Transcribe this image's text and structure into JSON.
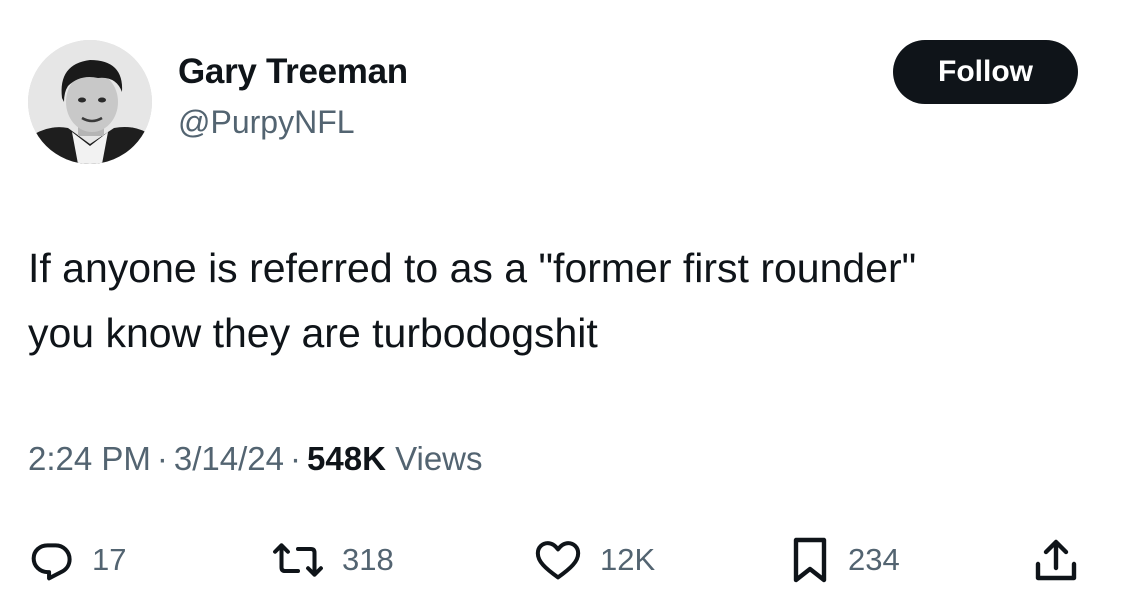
{
  "author": {
    "display_name": "Gary Treeman",
    "handle": "@PurpyNFL",
    "avatar_icon": "profile-photo"
  },
  "follow_button": {
    "label": "Follow"
  },
  "tweet": {
    "text_lines": [
      "If anyone is referred to as a \"former first rounder\"",
      "you know they are turbodogshit"
    ]
  },
  "meta": {
    "time": "2:24 PM",
    "separator": "·",
    "date": "3/14/24",
    "views_count": "548K",
    "views_label": "Views"
  },
  "actions": {
    "reply": {
      "icon": "reply-icon",
      "count": "17"
    },
    "retweet": {
      "icon": "retweet-icon",
      "count": "318"
    },
    "like": {
      "icon": "heart-icon",
      "count": "12K"
    },
    "bookmark": {
      "icon": "bookmark-icon",
      "count": "234"
    },
    "share": {
      "icon": "share-icon"
    }
  },
  "colors": {
    "text_primary": "#0f1419",
    "text_secondary": "#536471",
    "button_bg": "#0f1419",
    "background": "#ffffff"
  }
}
